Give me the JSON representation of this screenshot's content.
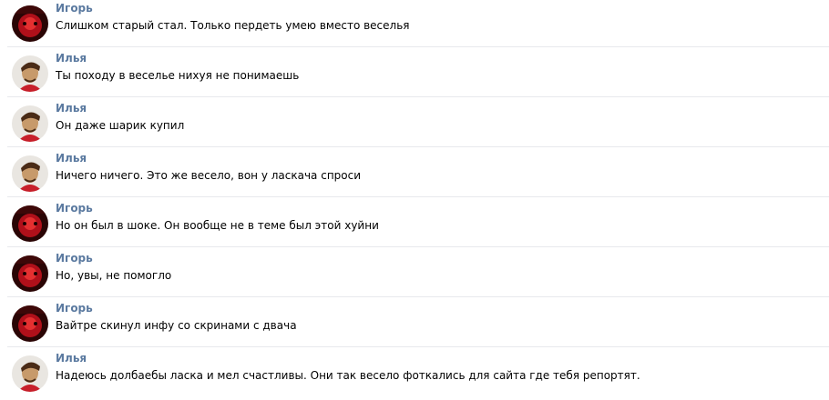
{
  "messages": [
    {
      "author": "Игорь",
      "avatar": "avatar-igor",
      "text": "Слишком старый стал. Только пердеть умею вместо веселья"
    },
    {
      "author": "Илья",
      "avatar": "avatar-ilya",
      "text": "Ты походу в веселье нихуя не понимаешь"
    },
    {
      "author": "Илья",
      "avatar": "avatar-ilya",
      "text": "Он даже шарик купил"
    },
    {
      "author": "Илья",
      "avatar": "avatar-ilya",
      "text": "Ничего ничего. Это же весело, вон у ласкача спроси"
    },
    {
      "author": "Игорь",
      "avatar": "avatar-igor",
      "text": "Но он был в шоке. Он вообще не в теме был этой хуйни"
    },
    {
      "author": "Игорь",
      "avatar": "avatar-igor",
      "text": "Но, увы, не помогло"
    },
    {
      "author": "Игорь",
      "avatar": "avatar-igor",
      "text": "Вайтре скинул инфу со скринами с двача"
    },
    {
      "author": "Илья",
      "avatar": "avatar-ilya",
      "text": "Надеюсь долбаебы ласка и мел счастливы. Они так весело фоткались для сайта где тебя репортят."
    }
  ],
  "colors": {
    "author": "#5b7aa0",
    "text": "#000000",
    "separator": "#e7e8ec"
  }
}
